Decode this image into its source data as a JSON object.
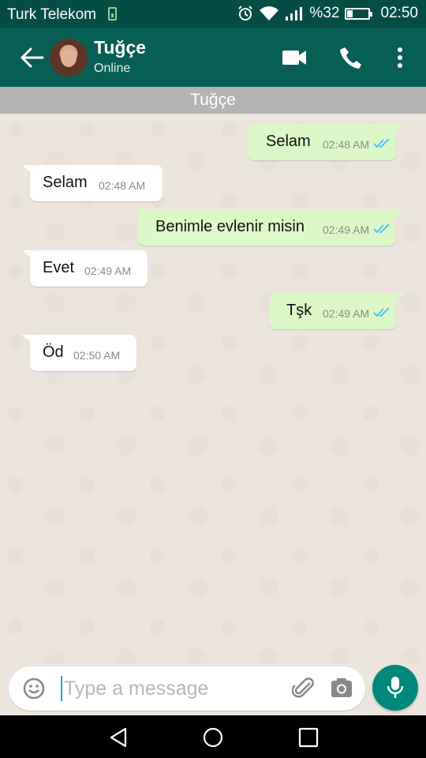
{
  "status_bar": {
    "carrier": "Turk Telekom",
    "battery_text": "%32",
    "time": "02:50",
    "icons": [
      "sim-icon",
      "alarm-icon",
      "wifi-icon",
      "signal-icon",
      "battery-icon"
    ]
  },
  "header": {
    "contact_name": "Tuğçe",
    "status": "Online",
    "icons": [
      "back-arrow-icon",
      "video-call-icon",
      "phone-call-icon",
      "more-vert-icon"
    ]
  },
  "banner": {
    "label": "Tuğçe"
  },
  "messages": [
    {
      "direction": "out",
      "text": "Selam",
      "time": "02:48 AM",
      "read": true
    },
    {
      "direction": "in",
      "text": "Selam",
      "time": "02:48 AM"
    },
    {
      "direction": "out",
      "text": "Benimle evlenir misin",
      "time": "02:49 AM",
      "read": true
    },
    {
      "direction": "in",
      "text": "Evet",
      "time": "02:49 AM"
    },
    {
      "direction": "out",
      "text": "Tşk",
      "time": "02:49 AM",
      "read": true
    },
    {
      "direction": "in",
      "text": "Öd",
      "time": "02:50 AM"
    }
  ],
  "composer": {
    "placeholder": "Type a message",
    "value": "",
    "icons": [
      "emoji-icon",
      "attach-icon",
      "camera-icon",
      "mic-icon"
    ]
  },
  "nav_bar": {
    "icons": [
      "nav-back-icon",
      "nav-home-icon",
      "nav-recents-icon"
    ]
  },
  "colors": {
    "status_bar": "#054d44",
    "app_bar": "#075e54",
    "banner": "#b4b4b2",
    "chat_bg": "#ece5dd",
    "bubble_out": "#dcf8c6",
    "bubble_in": "#ffffff",
    "read_ticks": "#4fc3f7",
    "mic_button": "#00897b"
  }
}
